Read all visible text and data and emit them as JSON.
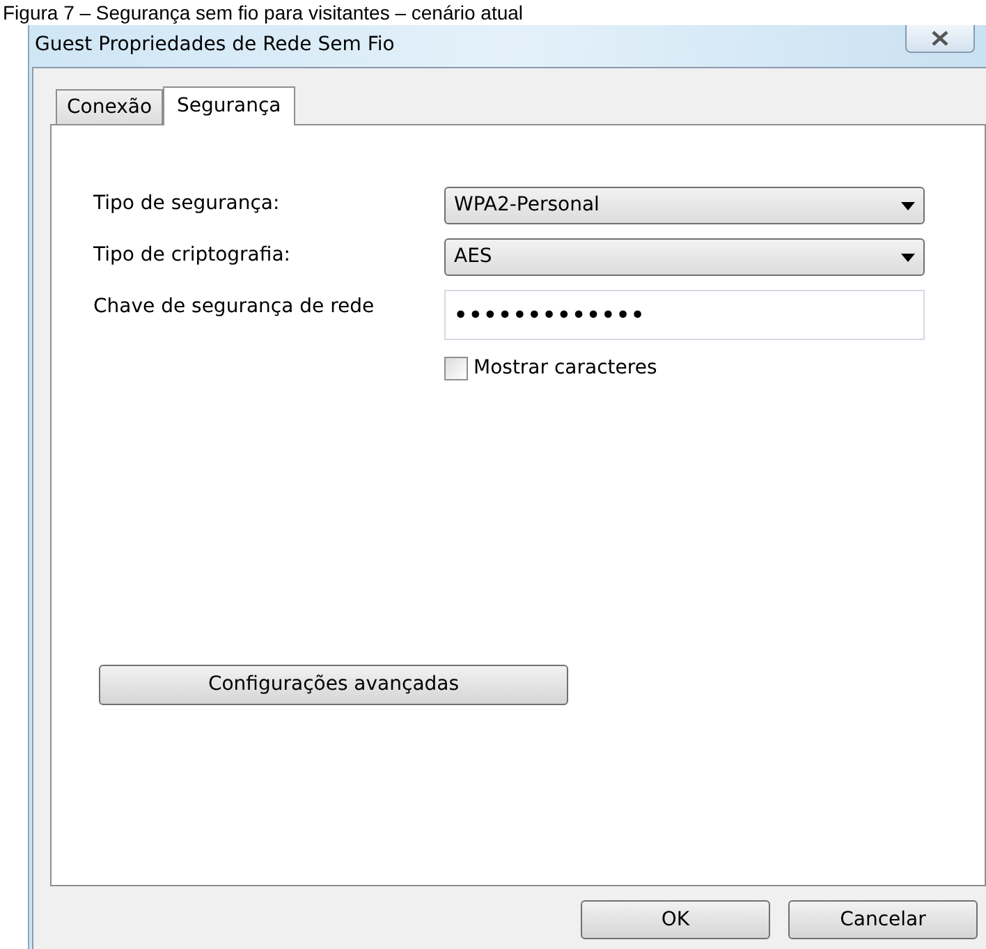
{
  "caption": "Figura 7 – Segurança sem fio para visitantes – cenário atual",
  "window": {
    "title": "Guest Propriedades de Rede Sem Fio"
  },
  "tabs": [
    {
      "label": "Conexão",
      "selected": false
    },
    {
      "label": "Segurança",
      "selected": true
    }
  ],
  "fields": [
    {
      "kind": "combo",
      "label": "Tipo de segurança:",
      "value": "WPA2-Personal"
    },
    {
      "kind": "combo",
      "label": "Tipo de criptografia:",
      "value": "AES"
    },
    {
      "kind": "password",
      "label": "Chave de segurança de rede",
      "value": "•••••••••••••"
    }
  ],
  "show_characters": {
    "label": "Mostrar caracteres",
    "checked": false
  },
  "advanced_button": "Configurações avançadas",
  "buttons": [
    "OK",
    "Cancelar"
  ]
}
